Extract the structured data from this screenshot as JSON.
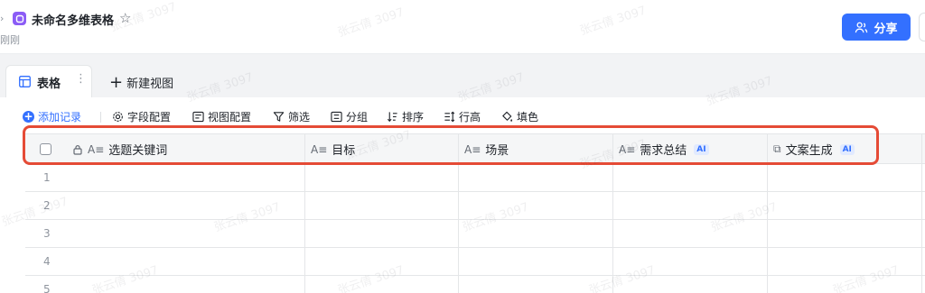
{
  "header": {
    "back_glyph": "›",
    "title": "未命名多维表格",
    "star_glyph": "☆",
    "status": "刚刚",
    "share_label": "分享",
    "accent": "#3370ff",
    "app_icon_color": "#8b5cf6"
  },
  "tabs": {
    "active_label": "表格",
    "more_glyph": "⋮",
    "new_view_label": "新建视图"
  },
  "toolbar": {
    "add_record": "添加记录",
    "field_config": "字段配置",
    "view_config": "视图配置",
    "filter": "筛选",
    "group": "分组",
    "sort": "排序",
    "row_height": "行高",
    "fill": "填色"
  },
  "table": {
    "columns": [
      {
        "label": "选题关键词",
        "type_glyph": "A≡",
        "locked": true
      },
      {
        "label": "目标",
        "type_glyph": "A≡"
      },
      {
        "label": "场景",
        "type_glyph": "A≡"
      },
      {
        "label": "需求总结",
        "type_glyph": "A≡",
        "badge": "AI"
      },
      {
        "label": "文案生成",
        "type_glyph": "⧉",
        "badge": "AI"
      }
    ],
    "rows": [
      "1",
      "2",
      "3",
      "4",
      "5"
    ]
  },
  "highlight_color": "#e54b36",
  "watermark": "张云倩 3097"
}
